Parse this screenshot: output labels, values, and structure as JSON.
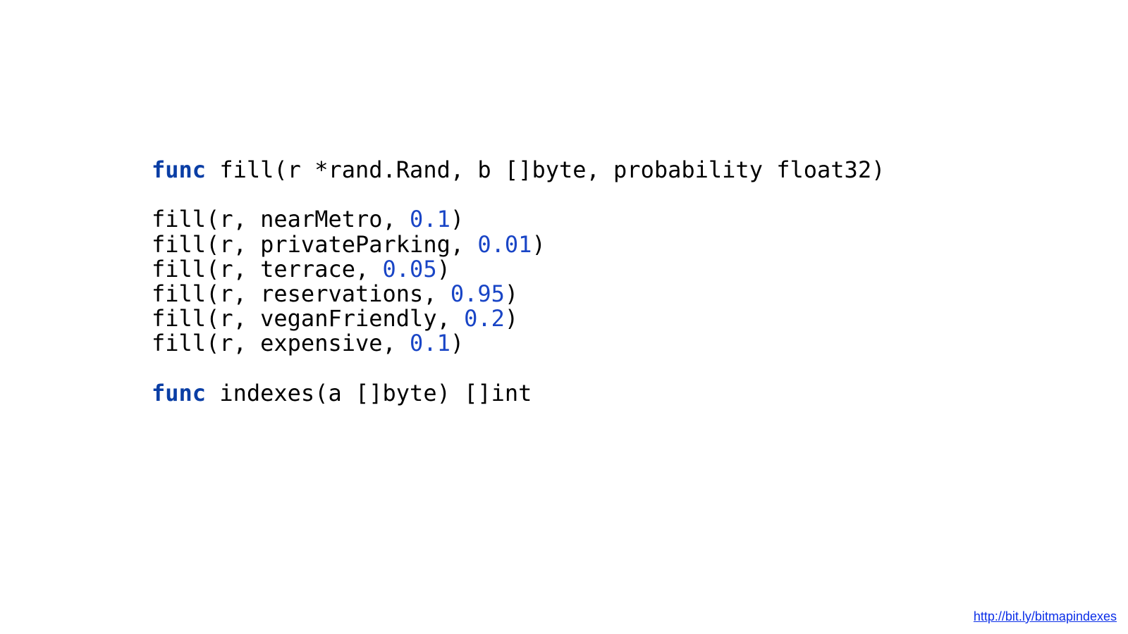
{
  "code": {
    "kw_func": "func",
    "sig1_pre": " fill(r *rand.Rand, b []byte, probability float32)",
    "call1_pre": "fill(r, nearMetro, ",
    "call1_num": "0.1",
    "call1_post": ")",
    "call2_pre": "fill(r, privateParking, ",
    "call2_num": "0.01",
    "call2_post": ")",
    "call3_pre": "fill(r, terrace, ",
    "call3_num": "0.05",
    "call3_post": ")",
    "call4_pre": "fill(r, reservations, ",
    "call4_num": "0.95",
    "call4_post": ")",
    "call5_pre": "fill(r, veganFriendly, ",
    "call5_num": "0.2",
    "call5_post": ")",
    "call6_pre": "fill(r, expensive, ",
    "call6_num": "0.1",
    "call6_post": ")",
    "sig2_pre": " indexes(a []byte) []int"
  },
  "footer": {
    "url": "http://bit.ly/bitmapindexes"
  }
}
